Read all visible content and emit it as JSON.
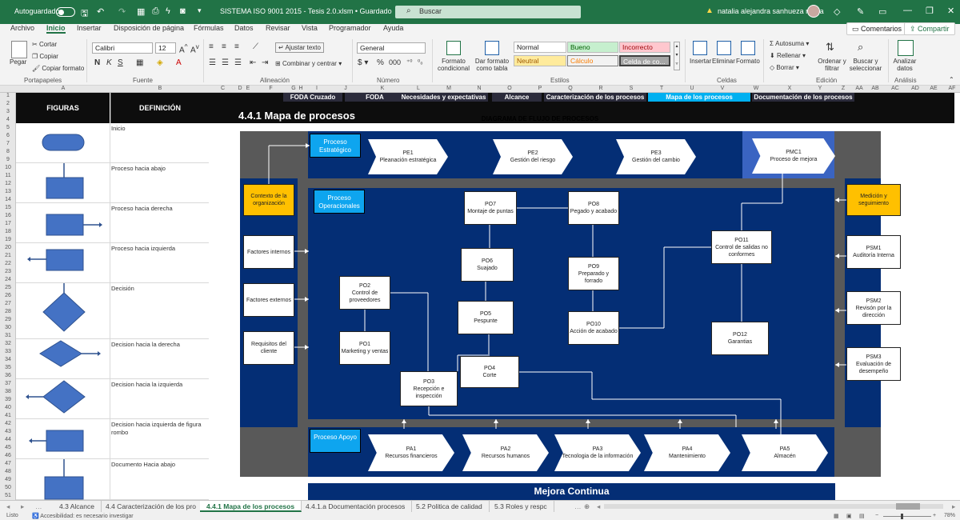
{
  "titlebar": {
    "autosave_label": "Autoguardado",
    "document_title": "SISTEMA ISO 9001 2015 - Tesis 2.0.xlsm  •  Guardado",
    "search_placeholder": "Buscar",
    "user_name": "natalia alejandra sanhueza rivera"
  },
  "ribbon_tabs": [
    {
      "label": "Archivo"
    },
    {
      "label": "Inicio"
    },
    {
      "label": "Insertar"
    },
    {
      "label": "Disposición de página"
    },
    {
      "label": "Fórmulas"
    },
    {
      "label": "Datos"
    },
    {
      "label": "Revisar"
    },
    {
      "label": "Vista"
    },
    {
      "label": "Programador"
    },
    {
      "label": "Ayuda"
    }
  ],
  "ribbon_actions": {
    "comments": "Comentarios",
    "share": "Compartir"
  },
  "ribbon": {
    "clipboard": {
      "paste": "Pegar",
      "cut": "Cortar",
      "copy": "Copiar",
      "format_painter": "Copiar formato",
      "label": "Portapapeles"
    },
    "font": {
      "name": "Calibri",
      "size": "12",
      "label": "Fuente"
    },
    "alignment": {
      "wrap": "Ajustar texto",
      "merge": "Combinar y centrar",
      "label": "Alineación"
    },
    "number": {
      "format": "General",
      "label": "Número"
    },
    "styles": {
      "conditional": "Formato condicional",
      "table": "Dar formato como tabla",
      "cells": [
        "Normal",
        "Bueno",
        "Incorrecto",
        "Neutral",
        "Cálculo",
        "Celda de co..."
      ],
      "label": "Estilos"
    },
    "cells": {
      "insert": "Insertar",
      "delete": "Eliminar",
      "format": "Formato",
      "label": "Celdas"
    },
    "editing": {
      "autosum": "Autosuma",
      "fill": "Rellenar",
      "clear": "Borrar",
      "sort": "Ordenar y filtrar",
      "find": "Buscar y seleccionar",
      "label": "Edición"
    },
    "analysis": {
      "analyze": "Analizar datos",
      "label": "Análisis"
    }
  },
  "columns": [
    "A",
    "B",
    "C",
    "D",
    "E",
    "F",
    "G",
    "H",
    "I",
    "J",
    "K",
    "L",
    "M",
    "N",
    "O",
    "P",
    "Q",
    "R",
    "S",
    "T",
    "U",
    "V",
    "W",
    "X",
    "Y",
    "Z",
    "AA",
    "AB",
    "AC",
    "AD",
    "AE",
    "AF"
  ],
  "rows": [
    "1",
    "2",
    "3",
    "4",
    "5",
    "6",
    "7",
    "8",
    "9",
    "10",
    "11",
    "12",
    "13",
    "14",
    "15",
    "16",
    "17",
    "18",
    "19",
    "20",
    "21",
    "22",
    "23",
    "24",
    "25",
    "26",
    "27",
    "28",
    "29",
    "30",
    "31",
    "32",
    "33",
    "34",
    "35",
    "36",
    "37",
    "38",
    "39",
    "40",
    "41",
    "42",
    "43",
    "44",
    "45",
    "46",
    "47",
    "48",
    "49",
    "50",
    "51"
  ],
  "legend_table": {
    "header_figures": "FIGURAS",
    "header_definition": "DEFINICIÓN",
    "rows": [
      {
        "definition": "Inicio",
        "figure": "start-terminal"
      },
      {
        "definition": "Proceso hacia abajo",
        "figure": "process-down"
      },
      {
        "definition": "Proceso hacia derecha",
        "figure": "process-right"
      },
      {
        "definition": "Proceso hacia izquierda",
        "figure": "process-left"
      },
      {
        "definition": "Decisión",
        "figure": "decision"
      },
      {
        "definition": "Decision hacia la derecha",
        "figure": "decision-right"
      },
      {
        "definition": "Decision hacia la izquierda",
        "figure": "decision-left"
      },
      {
        "definition": "Decision hacia izquierda de figura rombo",
        "figure": "process-left-from-rhombus"
      },
      {
        "definition": "Documento Hacia abajo",
        "figure": "document-down"
      }
    ]
  },
  "nav_tabs": [
    {
      "label": "FODA Cruzado",
      "active": false
    },
    {
      "label": "FODA",
      "active": false
    },
    {
      "label": "Necesidades y expectativas",
      "active": false
    },
    {
      "label": "Alcance",
      "active": false
    },
    {
      "label": "Caracterización de los procesos",
      "active": false
    },
    {
      "label": "Mapa de los procesos",
      "active": true
    },
    {
      "label": "Documentación de los procesos",
      "active": false
    }
  ],
  "page_title": "4.4.1 Mapa de procesos",
  "diagram_title": "DIAGRAMA DE FLUJO DE PROCESOS",
  "diagram": {
    "strategic_label": "Proceso Estratégico",
    "operational_label": "Proceso Operacionales",
    "support_label": "Proceso Apoyo",
    "strategic": [
      {
        "code": "PE1",
        "name": "Pleanación estratégica"
      },
      {
        "code": "PE2",
        "name": "Gestión del riesgo"
      },
      {
        "code": "PE3",
        "name": "Gestión del cambio"
      },
      {
        "code": "PMC1",
        "name": "Proceso de mejora"
      }
    ],
    "support": [
      {
        "code": "PA1",
        "name": "Recursos financieros"
      },
      {
        "code": "PA2",
        "name": "Recursos humanos"
      },
      {
        "code": "PA3",
        "name": "Tecnologia de la información"
      },
      {
        "code": "PA4",
        "name": "Mantenimiento"
      },
      {
        "code": "PA5",
        "name": "Almacén"
      }
    ],
    "inputs": [
      {
        "label": "Contexto de la organización"
      },
      {
        "label": "Factores internos"
      },
      {
        "label": "Factores externos"
      },
      {
        "label": "Requisitos del cliente"
      }
    ],
    "outputs": [
      {
        "label": "Medición y seguimiento"
      },
      {
        "code": "PSM1",
        "name": "Auditoría Interna"
      },
      {
        "code": "PSM2",
        "name": "Revisón por la dirección"
      },
      {
        "code": "PSM3",
        "name": "Evaluación de desempeño"
      }
    ],
    "operational": [
      {
        "code": "PO1",
        "name": "Marketing y ventas"
      },
      {
        "code": "PO2",
        "name": "Control de proveedores"
      },
      {
        "code": "PO3",
        "name": "Recepción e inspección"
      },
      {
        "code": "PO4",
        "name": "Corte"
      },
      {
        "code": "PO5",
        "name": "Pespunte"
      },
      {
        "code": "PO6",
        "name": "Suajado"
      },
      {
        "code": "PO7",
        "name": "Montaje de puntas"
      },
      {
        "code": "PO8",
        "name": "Pegado y acabado"
      },
      {
        "code": "PO9",
        "name": "Preparado y forrado"
      },
      {
        "code": "PO10",
        "name": "Acción de acabado"
      },
      {
        "code": "PO11",
        "name": "Control de salidas no conformes"
      },
      {
        "code": "PO12",
        "name": "Garantias"
      }
    ],
    "footer": "Mejora Continua"
  },
  "sheet_tabs": [
    {
      "label": "4.3 Alcance",
      "active": false
    },
    {
      "label": "4.4 Caracterización de los pro",
      "active": false
    },
    {
      "label": "4.4.1 Mapa de los procesos",
      "active": true
    },
    {
      "label": "4.4.1.a Documentación procesos",
      "active": false
    },
    {
      "label": "5.2 Politica de calidad",
      "active": false
    },
    {
      "label": "5.3 Roles y respc",
      "active": false
    }
  ],
  "status": {
    "mode": "Listo",
    "accessibility": "Accesibilidad: es necesario investigar",
    "zoom": "78%"
  },
  "colors": {
    "excel_green": "#217346",
    "navy": "#042e75",
    "cyan": "#0ea5ef",
    "yellow": "#ffc000",
    "gray": "#595959"
  }
}
